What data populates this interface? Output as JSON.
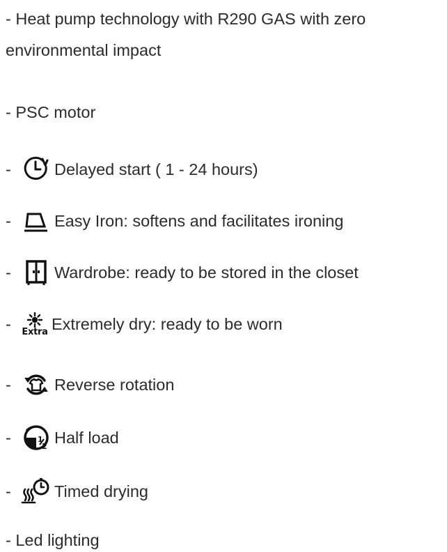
{
  "intro": {
    "line1": "- Heat pump technology with R290 GAS with zero",
    "line2": "environmental impact",
    "psc": "- PSC motor"
  },
  "features": [
    {
      "dash": "-",
      "icon": "delayed-start-clock-icon",
      "text": "Delayed start ( 1 - 24 hours)"
    },
    {
      "dash": "-",
      "icon": "iron-icon",
      "text": "Easy Iron: softens and facilitates ironing"
    },
    {
      "dash": "-",
      "icon": "wardrobe-icon",
      "text": "Wardrobe: ready to be stored in the closet"
    },
    {
      "dash": "-",
      "icon": "sun-extra-icon",
      "icon_label": "Extra",
      "text": "Extremely dry: ready to be  worn"
    },
    {
      "dash": "-",
      "icon": "reverse-rotation-icon",
      "text": "Reverse rotation"
    },
    {
      "dash": "-",
      "icon": "half-load-icon",
      "text": "Half load"
    },
    {
      "dash": "-",
      "icon": "timed-drying-icon",
      "text": "Timed drying"
    }
  ],
  "footer": {
    "led": "- Led lighting"
  },
  "colors": {
    "text": "#2b2b2b",
    "icon": "#111111"
  }
}
